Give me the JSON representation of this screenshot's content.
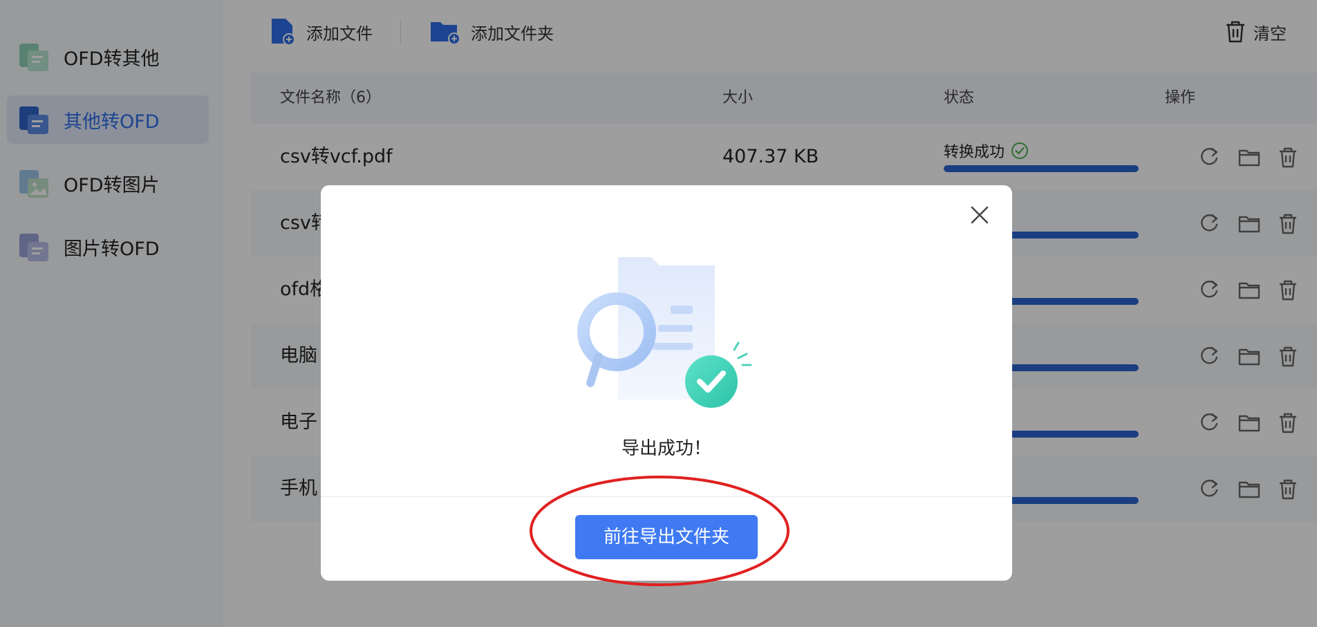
{
  "sidebar": {
    "items": [
      {
        "label": "OFD转其他",
        "icon": "ofd-to-other-icon"
      },
      {
        "label": "其他转OFD",
        "icon": "other-to-ofd-icon",
        "active": true
      },
      {
        "label": "OFD转图片",
        "icon": "ofd-to-image-icon"
      },
      {
        "label": "图片转OFD",
        "icon": "image-to-ofd-icon"
      }
    ]
  },
  "toolbar": {
    "add_file": "添加文件",
    "add_folder": "添加文件夹",
    "clear": "清空"
  },
  "table": {
    "headers": {
      "name": "文件名称（6）",
      "size": "大小",
      "status": "状态",
      "ops": "操作"
    },
    "rows": [
      {
        "name": "csv转vcf.pdf",
        "size": "407.37 KB",
        "status": "转换成功",
        "progress": 1.0
      },
      {
        "name": "csv转",
        "size": "",
        "status": "",
        "progress": 1.0
      },
      {
        "name": "ofd格",
        "size": "",
        "status": "",
        "progress": 1.0
      },
      {
        "name": "电脑",
        "size": "",
        "status": "",
        "progress": 1.0
      },
      {
        "name": "电子",
        "size": "",
        "status": "",
        "progress": 1.0
      },
      {
        "name": "手机",
        "size": "",
        "status": "",
        "progress": 1.0
      }
    ]
  },
  "modal": {
    "message": "导出成功！",
    "button": "前往导出文件夹"
  },
  "colors": {
    "accent": "#3f7af3",
    "progress": "#2c64d0",
    "success": "#4caf50",
    "annotation": "#e02020"
  }
}
